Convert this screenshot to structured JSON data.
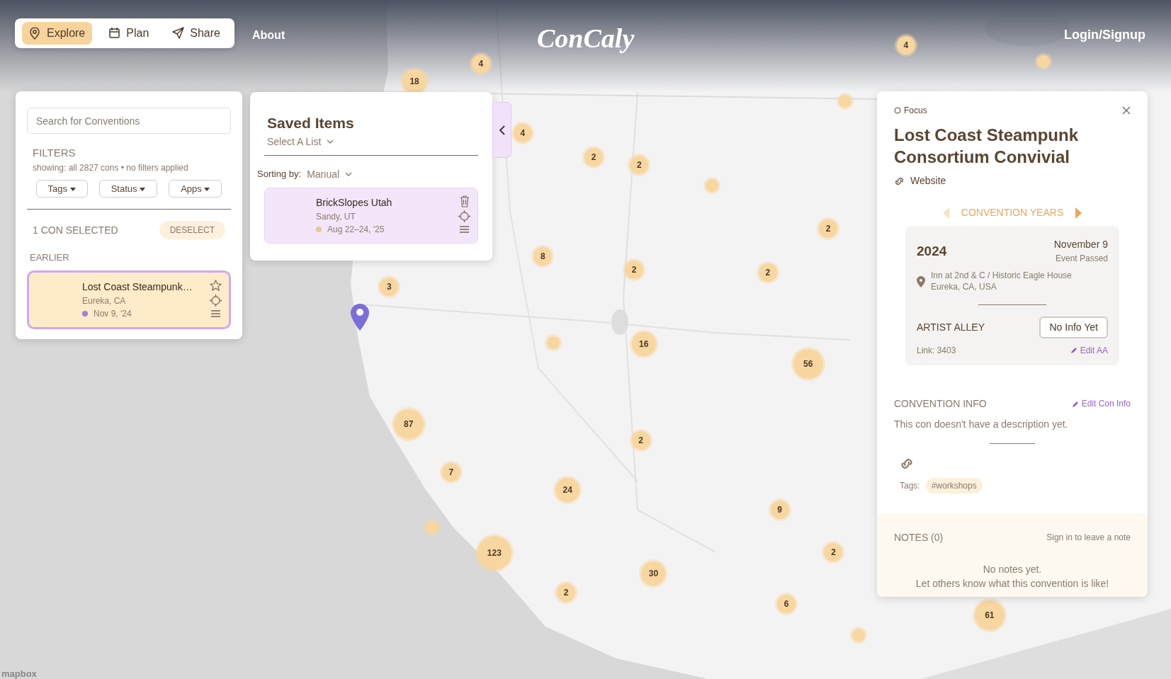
{
  "nav": {
    "tabs": [
      {
        "label": "Explore",
        "selected": true
      },
      {
        "label": "Plan",
        "selected": false
      },
      {
        "label": "Share",
        "selected": false
      }
    ],
    "about": "About",
    "logo": "ConCaly",
    "login": "Login/Signup"
  },
  "search_panel": {
    "search": {
      "placeholder": "Search for Conventions"
    },
    "filters_title": "FILTERS",
    "showing": "showing: all 2827 cons • no filters applied",
    "filter_buttons": [
      "Tags",
      "Status",
      "Apps"
    ],
    "selected_count": "1 CON SELECTED",
    "deselect": "DESELECT",
    "group": "EARLIER",
    "cards": [
      {
        "name": "Lost Coast Steampunk…",
        "location": "Eureka, CA",
        "date": "Nov 9, '24",
        "color": "#a77bd9",
        "selected": true
      }
    ]
  },
  "saved": {
    "title": "Saved Items",
    "list_select": "Select A List",
    "sorting_label": "Sorting by:",
    "sorting_value": "Manual",
    "items": [
      {
        "name": "BrickSlopes Utah",
        "location": "Sandy, UT",
        "date": "Aug 22–24, '25",
        "color": "#e8c98f"
      }
    ]
  },
  "focus": {
    "label": "Focus",
    "title": "Lost Coast Steampunk Consortium Convivial",
    "website": "Website",
    "years_label": "CONVENTION YEARS",
    "prev_disabled": true,
    "next_disabled": false,
    "year": {
      "year": "2024",
      "date": "November 9",
      "status": "Event Passed",
      "venue": "Inn at 2nd & C / Historic Eagle House",
      "address": "Eureka, CA, USA",
      "aa_label": "ARTIST ALLEY",
      "aa_status": "No Info Yet",
      "link": "Link: 3403",
      "edit_aa": "Edit AA"
    },
    "info_title": "CONVENTION INFO",
    "edit_info": "Edit Con Info",
    "description": "This con doesn't have a description yet.",
    "tags_label": "Tags:",
    "tags": [
      "#workshops"
    ],
    "notes_title": "NOTES (0)",
    "sign_in": "Sign in to leave a note",
    "no_notes": "No notes yet.",
    "notes_hint": "Let others know what this convention is like!"
  },
  "map": {
    "clusters": [
      "4",
      "18",
      "4",
      "4",
      "2",
      "2",
      "2",
      "8",
      "2",
      "2",
      "3",
      "16",
      "56",
      "87",
      "2",
      "7",
      "24",
      "9",
      "2",
      "123",
      "30",
      "2",
      "6",
      "61"
    ],
    "attribution": "mapbox"
  }
}
